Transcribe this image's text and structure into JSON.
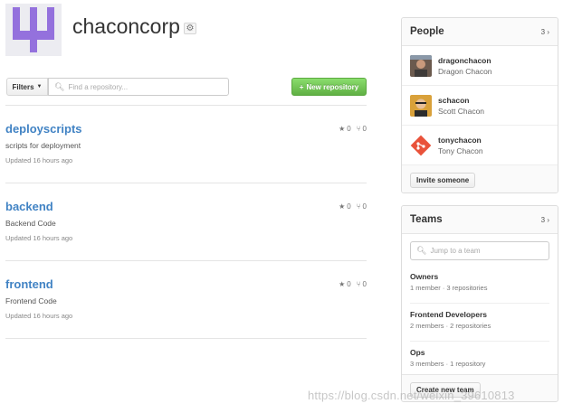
{
  "org": {
    "name": "chaconcorp",
    "logo_icon": "trident-logo",
    "logo_color": "#9471dd",
    "settings_icon": "gear-icon"
  },
  "toolbar": {
    "filters_label": "Filters",
    "search_placeholder": "Find a repository...",
    "new_repo_label": "New repository",
    "new_repo_color": "#60b044"
  },
  "repos": [
    {
      "name": "deployscripts",
      "description": "scripts for deployment",
      "updated": "Updated 16 hours ago",
      "stars": "0",
      "forks": "0"
    },
    {
      "name": "backend",
      "description": "Backend Code",
      "updated": "Updated 16 hours ago",
      "stars": "0",
      "forks": "0"
    },
    {
      "name": "frontend",
      "description": "Frontend Code",
      "updated": "Updated 16 hours ago",
      "stars": "0",
      "forks": "0"
    }
  ],
  "people": {
    "title": "People",
    "count": "3",
    "members": [
      {
        "login": "dragonchacon",
        "name": "Dragon Chacon"
      },
      {
        "login": "schacon",
        "name": "Scott Chacon"
      },
      {
        "login": "tonychacon",
        "name": "Tony Chacon"
      }
    ],
    "invite_label": "Invite someone"
  },
  "teams": {
    "title": "Teams",
    "count": "3",
    "search_placeholder": "Jump to a team",
    "items": [
      {
        "name": "Owners",
        "meta": "1 member · 3 repositories"
      },
      {
        "name": "Frontend Developers",
        "meta": "2 members · 2 repositories"
      },
      {
        "name": "Ops",
        "meta": "3 members · 1 repository"
      }
    ],
    "create_label": "Create new team"
  },
  "watermark": "https://blog.csdn.net/weixin_39610813",
  "colors": {
    "link": "#4183c4",
    "border": "#dddddd"
  }
}
